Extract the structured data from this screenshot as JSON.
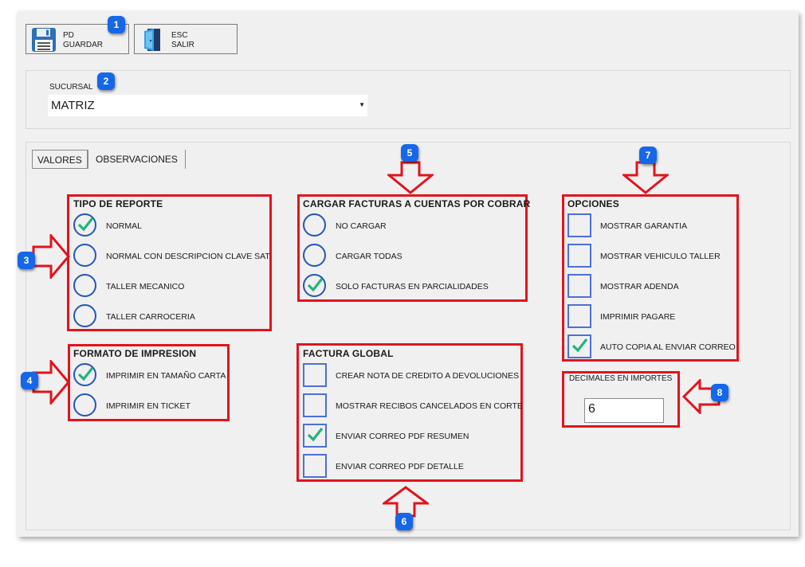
{
  "toolbar": {
    "save": {
      "key": "PD",
      "label": "GUARDAR",
      "icon": "floppy-disk-icon"
    },
    "exit": {
      "key": "ESC",
      "label": "SALIR",
      "icon": "door-exit-icon"
    }
  },
  "sucursal": {
    "label": "SUCURSAL",
    "value": "MATRIZ"
  },
  "tabs": [
    {
      "label": "VALORES",
      "active": true
    },
    {
      "label": "OBSERVACIONES",
      "active": false
    }
  ],
  "tipo_reporte": {
    "title": "TIPO DE REPORTE",
    "options": [
      {
        "label": "NORMAL",
        "selected": true
      },
      {
        "label": "NORMAL CON DESCRIPCION CLAVE SAT",
        "selected": false
      },
      {
        "label": "TALLER MECANICO",
        "selected": false
      },
      {
        "label": "TALLER CARROCERIA",
        "selected": false
      }
    ]
  },
  "formato_impresion": {
    "title": "FORMATO DE IMPRESION",
    "options": [
      {
        "label": "IMPRIMIR EN TAMAÑO CARTA",
        "selected": true
      },
      {
        "label": "IMPRIMIR EN TICKET",
        "selected": false
      }
    ]
  },
  "cargar_facturas": {
    "title": "CARGAR FACTURAS A CUENTAS POR COBRAR",
    "options": [
      {
        "label": "NO CARGAR",
        "selected": false
      },
      {
        "label": "CARGAR TODAS",
        "selected": false
      },
      {
        "label": "SOLO FACTURAS EN PARCIALIDADES",
        "selected": true
      }
    ]
  },
  "factura_global": {
    "title": "FACTURA GLOBAL",
    "options": [
      {
        "label": "CREAR NOTA DE CREDITO A DEVOLUCIONES",
        "checked": false
      },
      {
        "label": "MOSTRAR RECIBOS CANCELADOS EN CORTE",
        "checked": false
      },
      {
        "label": "ENVIAR CORREO PDF RESUMEN",
        "checked": true
      },
      {
        "label": "ENVIAR CORREO PDF DETALLE",
        "checked": false
      }
    ]
  },
  "opciones": {
    "title": "OPCIONES",
    "options": [
      {
        "label": "MOSTRAR GARANTIA",
        "checked": false
      },
      {
        "label": "MOSTRAR VEHICULO TALLER",
        "checked": false
      },
      {
        "label": "MOSTRAR ADENDA",
        "checked": false
      },
      {
        "label": "IMPRIMIR PAGARE",
        "checked": false
      },
      {
        "label": "AUTO COPIA AL ENVIAR CORREO",
        "checked": true
      }
    ]
  },
  "decimales": {
    "label": "DECIMALES EN IMPORTES",
    "value": "6"
  },
  "badges": [
    "1",
    "2",
    "3",
    "4",
    "5",
    "6",
    "7",
    "8"
  ],
  "colors": {
    "accent_red": "#e2131d",
    "badge_blue": "#1667e8",
    "radio_blue": "#2456b6",
    "check_green": "#1fb57c"
  }
}
